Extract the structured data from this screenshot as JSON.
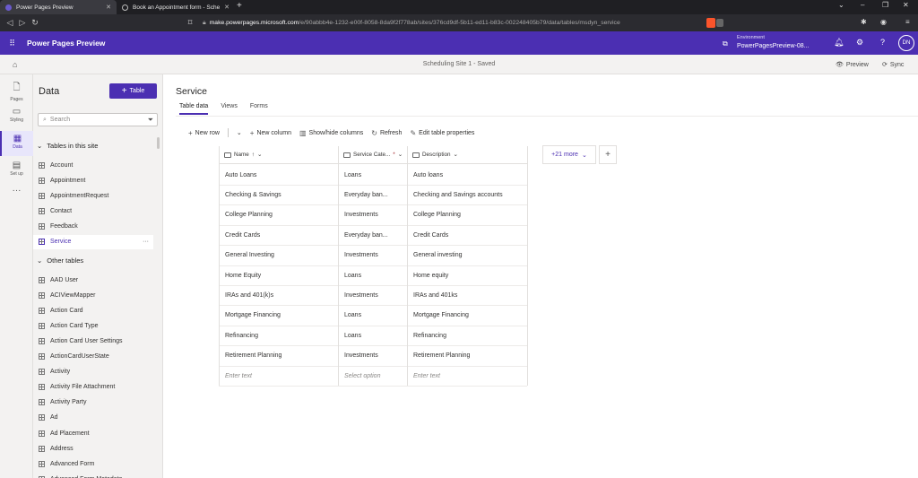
{
  "browser": {
    "tabs": [
      {
        "title": "Power Pages Preview"
      },
      {
        "title": "Book an Appointment form - Scheduli..."
      }
    ],
    "url_host": "make.powerpages.microsoft.com",
    "url_path": "/e/90abbb4e-1232-e00f-8058-8da9f2f778ab/sites/376cd9df-5b11-ed11-b83c-002248405b79/data/tables/msdyn_service"
  },
  "app": {
    "title": "Power Pages Preview",
    "env_label": "Environment",
    "env_name": "PowerPagesPreview-08...",
    "avatar": "DN"
  },
  "sitebar": {
    "status": "Scheduling Site 1 - Saved",
    "preview": "Preview",
    "sync": "Sync"
  },
  "rail": [
    {
      "label": "Pages",
      "icon": "page-icon"
    },
    {
      "label": "Styling",
      "icon": "paint-icon"
    },
    {
      "label": "Data",
      "icon": "data-icon"
    },
    {
      "label": "Set up",
      "icon": "setup-icon"
    }
  ],
  "panel": {
    "title": "Data",
    "add_label": "Table",
    "search_placeholder": "Search",
    "section_site": "Tables in this site",
    "site_tables": [
      "Account",
      "Appointment",
      "AppointmentRequest",
      "Contact",
      "Feedback",
      "Service"
    ],
    "section_other": "Other tables",
    "other_tables": [
      "AAD User",
      "ACIViewMapper",
      "Action Card",
      "Action Card Type",
      "Action Card User Settings",
      "ActionCardUserState",
      "Activity",
      "Activity File Attachment",
      "Activity Party",
      "Ad",
      "Ad Placement",
      "Address",
      "Advanced Form",
      "Advanced Form Metadata"
    ]
  },
  "main": {
    "title": "Service",
    "tabs": [
      "Table data",
      "Views",
      "Forms"
    ],
    "commands": {
      "new_row": "New row",
      "new_column": "New column",
      "show_hide": "Show/hide columns",
      "refresh": "Refresh",
      "edit_props": "Edit table properties"
    },
    "columns": [
      "Name",
      "Service Cate...",
      "Description"
    ],
    "more_columns": "+21 more",
    "rows": [
      [
        "Auto Loans",
        "Loans",
        "Auto loans"
      ],
      [
        "Checking & Savings",
        "Everyday ban...",
        "Checking and Savings accounts"
      ],
      [
        "College Planning",
        "Investments",
        "College Planning"
      ],
      [
        "Credit Cards",
        "Everyday ban...",
        "Credit Cards"
      ],
      [
        "General Investing",
        "Investments",
        "General investing"
      ],
      [
        "Home Equity",
        "Loans",
        "Home equity"
      ],
      [
        "IRAs and 401(k)s",
        "Investments",
        "IRAs and 401ks"
      ],
      [
        "Mortgage Financing",
        "Loans",
        "Mortgage Financing"
      ],
      [
        "Refinancing",
        "Loans",
        "Refinancing"
      ],
      [
        "Retirement Planning",
        "Investments",
        "Retirement Planning"
      ]
    ],
    "new_row_placeholders": [
      "Enter text",
      "Select option",
      "Enter text"
    ]
  }
}
